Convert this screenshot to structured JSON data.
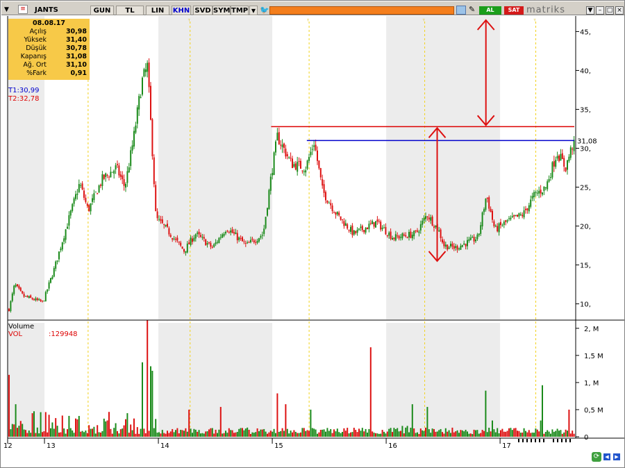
{
  "toolbar": {
    "symbol": "JANTS",
    "buttons": [
      "GUN",
      "TL",
      "LIN",
      "KHN",
      "SVD",
      "SYM",
      "TMP"
    ],
    "buy_label": "AL",
    "sell_label": "SAT",
    "brand": "matriks"
  },
  "info": {
    "date": "08.08.17",
    "rows": [
      {
        "label": "Açılış",
        "value": "30,98"
      },
      {
        "label": "Yüksek",
        "value": "31,40"
      },
      {
        "label": "Düşük",
        "value": "30,78"
      },
      {
        "label": "Kapanış",
        "value": "31,08"
      },
      {
        "label": "Ağ. Ort",
        "value": "31,10"
      },
      {
        "label": "%Fark",
        "value": "0,91"
      }
    ]
  },
  "trendlines": {
    "t1": "T1:30,99",
    "t2": "T2:32,78",
    "t1_color": "#0000cc",
    "t2_color": "#dd0000"
  },
  "volume_panel": {
    "title": "Volume",
    "vol_label": "VOL",
    "vol_value": ":129948"
  },
  "colors": {
    "up": "#1a8a1a",
    "down": "#dd1111",
    "shade": "#ececec",
    "accent_orange": "#f47e1c"
  },
  "chart_data": [
    {
      "type": "candlestick",
      "ylim": [
        8,
        47
      ],
      "y_ticks": [
        "10,",
        "15,",
        "20,",
        "25,",
        "30,",
        "35,",
        "40,",
        "45,"
      ],
      "y_tick_values": [
        10,
        15,
        20,
        25,
        30,
        35,
        40,
        45
      ],
      "last_price_label": "31,08",
      "last_price": 31.08,
      "resistance_level": 32.78,
      "blue_level": 30.99,
      "x_tick_labels": [
        "12",
        "13",
        "14",
        "15",
        "16",
        "17"
      ],
      "anchors": [
        {
          "t": 0.0,
          "v": 9.3
        },
        {
          "t": 0.01,
          "v": 12.5
        },
        {
          "t": 0.025,
          "v": 11.0
        },
        {
          "t": 0.06,
          "v": 10.2
        },
        {
          "t": 0.08,
          "v": 14.5
        },
        {
          "t": 0.1,
          "v": 19.5
        },
        {
          "t": 0.125,
          "v": 25.5
        },
        {
          "t": 0.14,
          "v": 22.0
        },
        {
          "t": 0.165,
          "v": 26.0
        },
        {
          "t": 0.19,
          "v": 27.5
        },
        {
          "t": 0.205,
          "v": 25.0
        },
        {
          "t": 0.22,
          "v": 31.0
        },
        {
          "t": 0.235,
          "v": 38.5
        },
        {
          "t": 0.245,
          "v": 40.5
        },
        {
          "t": 0.255,
          "v": 28.0
        },
        {
          "t": 0.26,
          "v": 21.0
        },
        {
          "t": 0.28,
          "v": 19.5
        },
        {
          "t": 0.31,
          "v": 16.8
        },
        {
          "t": 0.33,
          "v": 19.0
        },
        {
          "t": 0.36,
          "v": 17.2
        },
        {
          "t": 0.385,
          "v": 19.8
        },
        {
          "t": 0.42,
          "v": 17.5
        },
        {
          "t": 0.45,
          "v": 19.0
        },
        {
          "t": 0.465,
          "v": 27.0
        },
        {
          "t": 0.475,
          "v": 31.5
        },
        {
          "t": 0.5,
          "v": 28.0
        },
        {
          "t": 0.525,
          "v": 27.5
        },
        {
          "t": 0.54,
          "v": 30.8
        },
        {
          "t": 0.555,
          "v": 24.5
        },
        {
          "t": 0.58,
          "v": 21.5
        },
        {
          "t": 0.61,
          "v": 19.0
        },
        {
          "t": 0.65,
          "v": 20.5
        },
        {
          "t": 0.68,
          "v": 18.5
        },
        {
          "t": 0.72,
          "v": 19.0
        },
        {
          "t": 0.74,
          "v": 21.5
        },
        {
          "t": 0.76,
          "v": 19.5
        },
        {
          "t": 0.77,
          "v": 17.5
        },
        {
          "t": 0.79,
          "v": 17.2
        },
        {
          "t": 0.83,
          "v": 18.5
        },
        {
          "t": 0.845,
          "v": 24.0
        },
        {
          "t": 0.86,
          "v": 19.5
        },
        {
          "t": 0.88,
          "v": 20.5
        },
        {
          "t": 0.91,
          "v": 21.5
        },
        {
          "t": 0.93,
          "v": 24.0
        },
        {
          "t": 0.95,
          "v": 25.0
        },
        {
          "t": 0.97,
          "v": 29.5
        },
        {
          "t": 0.985,
          "v": 27.5
        },
        {
          "t": 1.0,
          "v": 31.08
        }
      ],
      "count": 340
    },
    {
      "type": "bar",
      "title": "Volume",
      "ylim": [
        0,
        2.1
      ],
      "y_ticks": [
        "0",
        "0,5 M",
        "1, M",
        "1,5 M",
        "2, M"
      ],
      "y_tick_values": [
        0,
        0.5,
        1.0,
        1.5,
        2.0
      ],
      "spikes": [
        {
          "t": 0.0,
          "v": 0.9
        },
        {
          "t": 0.012,
          "v": 0.6
        },
        {
          "t": 0.045,
          "v": 0.3
        },
        {
          "t": 0.19,
          "v": 0.25
        },
        {
          "t": 0.235,
          "v": 1.1
        },
        {
          "t": 0.245,
          "v": 2.0
        },
        {
          "t": 0.25,
          "v": 1.3
        },
        {
          "t": 0.255,
          "v": 1.0
        },
        {
          "t": 0.32,
          "v": 0.5
        },
        {
          "t": 0.375,
          "v": 0.55
        },
        {
          "t": 0.475,
          "v": 0.8
        },
        {
          "t": 0.49,
          "v": 0.6
        },
        {
          "t": 0.535,
          "v": 0.5
        },
        {
          "t": 0.64,
          "v": 1.65
        },
        {
          "t": 0.695,
          "v": 0.2
        },
        {
          "t": 0.705,
          "v": 0.2
        },
        {
          "t": 0.715,
          "v": 0.6
        },
        {
          "t": 0.74,
          "v": 0.55
        },
        {
          "t": 0.845,
          "v": 0.85
        },
        {
          "t": 0.855,
          "v": 0.3
        },
        {
          "t": 0.94,
          "v": 0.3
        },
        {
          "t": 0.945,
          "v": 0.95
        },
        {
          "t": 0.99,
          "v": 0.5
        }
      ]
    }
  ]
}
